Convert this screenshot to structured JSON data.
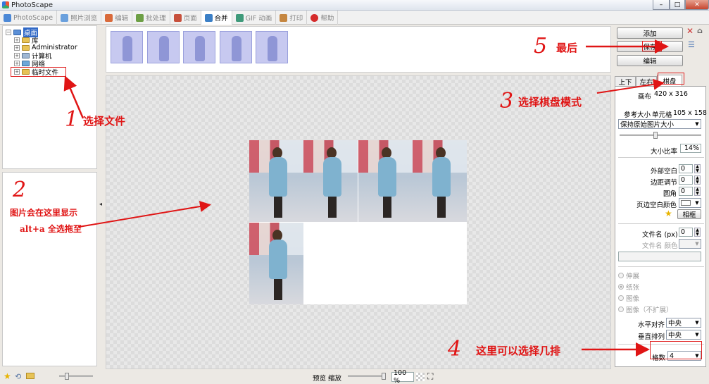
{
  "window": {
    "title": "PhotoScape",
    "min": "–",
    "max": "□",
    "close": "✕"
  },
  "tabs": [
    {
      "label": "PhotoScape",
      "icon": "photoscape-icon",
      "color": "#4c88d6"
    },
    {
      "label": "照片浏览",
      "icon": "viewer-icon",
      "color": "#6aa0dd"
    },
    {
      "label": "编辑",
      "icon": "editor-icon",
      "color": "#d96a3a"
    },
    {
      "label": "批处理",
      "icon": "batch-icon",
      "color": "#6d9f45"
    },
    {
      "label": "页面",
      "icon": "page-icon",
      "color": "#c7503c"
    },
    {
      "label": "合并",
      "icon": "combine-icon",
      "color": "#3b7fc6"
    },
    {
      "label": "GIF 动画",
      "icon": "gif-icon",
      "color": "#3f9a7a"
    },
    {
      "label": "打印",
      "icon": "print-icon",
      "color": "#c58640"
    },
    {
      "label": "帮助",
      "icon": "help-icon",
      "color": "#d52b2b"
    }
  ],
  "tree": {
    "root": "桌面",
    "items": [
      "库",
      "Administrator",
      "计算机",
      "网络",
      "临时文件"
    ]
  },
  "right": {
    "buttons": {
      "add": "添加",
      "save": "保存",
      "edit": "编辑"
    },
    "tabs": [
      "上下",
      "左右",
      "棋盘"
    ],
    "canvas_label": "画布",
    "canvas_value": "420 x 316",
    "ref_size_label": "参考大小",
    "cell_label": "单元格",
    "cell_value": "105 x 158",
    "size_mode": "保持原始图片大小",
    "scale_label": "大小比率",
    "scale_value": "14%",
    "outer_margin_label": "外部空白",
    "outer_margin_value": "0",
    "margin_adjust_label": "边距调节",
    "margin_adjust_value": "0",
    "round_label": "圆角",
    "round_value": "0",
    "margin_color_label": "页边空白颜色",
    "frame_button": "相框",
    "filename_label": "文件名 (px)",
    "filename_value": "0",
    "filename_color_label": "文件名 颜色",
    "radios": [
      "伸展",
      "纸张",
      "图像",
      "图像（不扩展）"
    ],
    "halign_label": "水平对齐",
    "halign_value": "中央",
    "valign_label": "垂直排列",
    "valign_value": "中央",
    "count_label": "格数",
    "count_value": "4"
  },
  "status": {
    "preview_label": "预览 缩放",
    "zoom_value": "100 %"
  },
  "annotations": {
    "n1": "1",
    "t1": "选择文件",
    "n2": "2",
    "t2a": "图片会在这里显示",
    "t2b": "alt+a 全选拖至",
    "n3": "3",
    "t3": "选择棋盘模式",
    "n4": "4",
    "t4": "这里可以选择几排",
    "n5": "5",
    "t5": "最后"
  }
}
